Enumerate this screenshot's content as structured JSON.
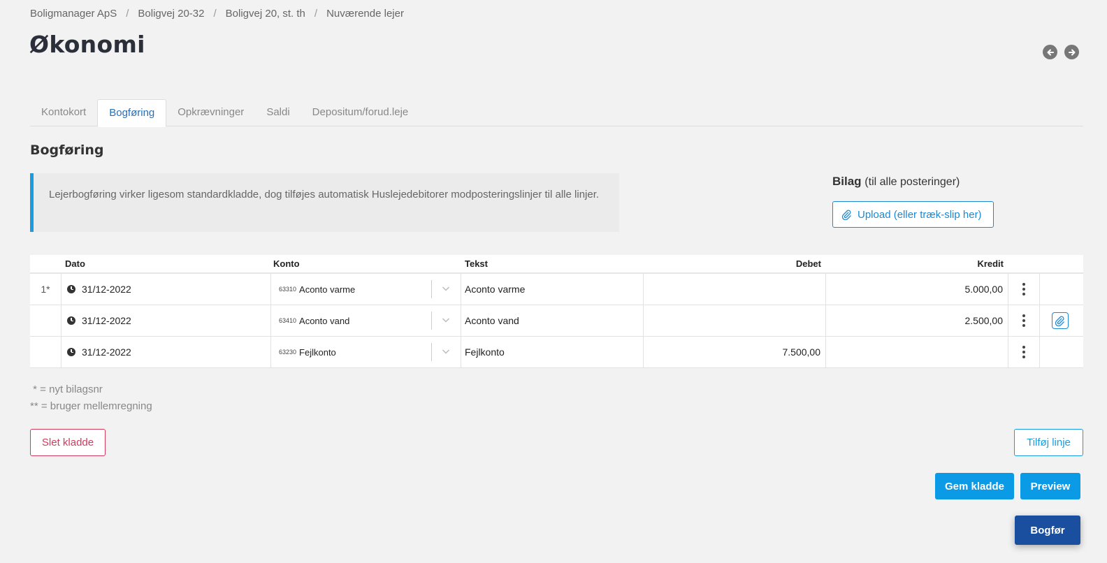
{
  "breadcrumb": [
    "Boligmanager ApS",
    "Boligvej 20-32",
    "Boligvej 20, st. th",
    "Nuværende lejer"
  ],
  "page_title": "Økonomi",
  "tabs": [
    {
      "label": "Kontokort",
      "active": false
    },
    {
      "label": "Bogføring",
      "active": true
    },
    {
      "label": "Opkrævninger",
      "active": false
    },
    {
      "label": "Saldi",
      "active": false
    },
    {
      "label": "Depositum/forud.leje",
      "active": false
    }
  ],
  "section_title": "Bogføring",
  "info_text": "Lejerbogføring virker ligesom standardkladde, dog tilføjes automatisk Huslejedebitorer modposteringslinjer til alle linjer.",
  "bilag": {
    "title": "Bilag",
    "subtitle": "(til alle posteringer)",
    "upload_label": "Upload (eller træk-slip her)"
  },
  "table": {
    "headers": {
      "dato": "Dato",
      "konto": "Konto",
      "tekst": "Tekst",
      "debet": "Debet",
      "kredit": "Kredit"
    },
    "rows": [
      {
        "num": "1*",
        "dato": "31/12-2022",
        "konto_code": "63310",
        "konto_name": "Aconto varme",
        "tekst": "Aconto varme",
        "debet": "",
        "kredit": "5.000,00"
      },
      {
        "num": "",
        "dato": "31/12-2022",
        "konto_code": "63410",
        "konto_name": "Aconto vand",
        "tekst": "Aconto vand",
        "debet": "",
        "kredit": "2.500,00"
      },
      {
        "num": "",
        "dato": "31/12-2022",
        "konto_code": "63230",
        "konto_name": "Fejlkonto",
        "tekst": "Fejlkonto",
        "debet": "7.500,00",
        "kredit": ""
      }
    ]
  },
  "legend": {
    "line1": " * = nyt bilagsnr",
    "line2": "** = bruger mellemregning"
  },
  "buttons": {
    "slet": "Slet kladde",
    "tilfoj": "Tilføj linje",
    "gem": "Gem kladde",
    "preview": "Preview",
    "bogfor": "Bogfør"
  },
  "colors": {
    "accent": "#1a9de0",
    "primary_button": "#0b9ae6",
    "bogfor_button": "#1a4fa0",
    "danger": "#d43a5a"
  }
}
